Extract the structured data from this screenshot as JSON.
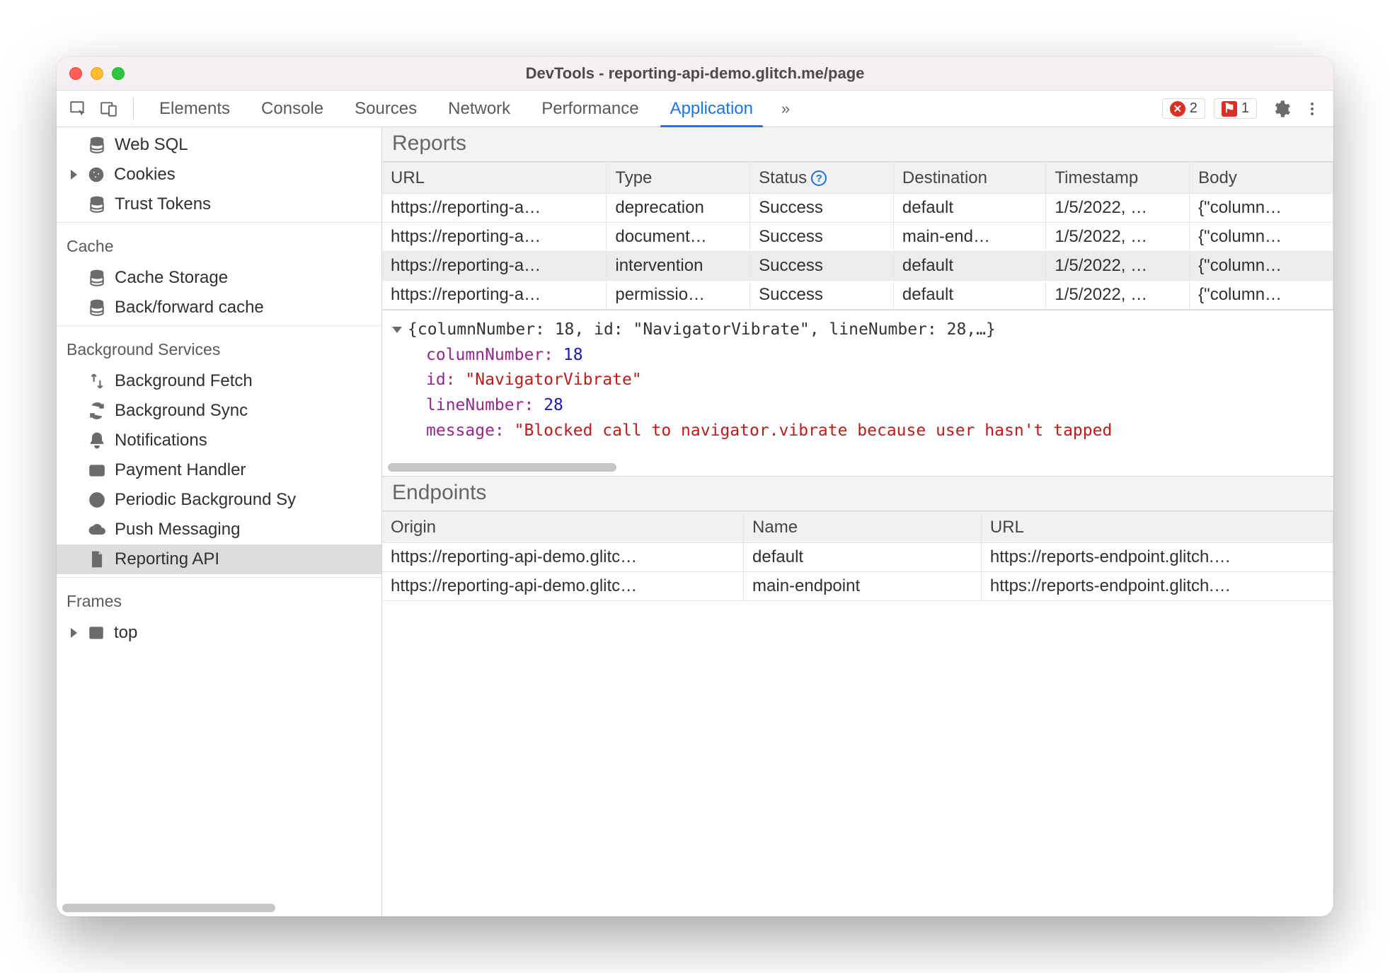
{
  "title": "DevTools - reporting-api-demo.glitch.me/page",
  "tabs": [
    "Elements",
    "Console",
    "Sources",
    "Network",
    "Performance",
    "Application"
  ],
  "active_tab": "Application",
  "overflow_indicator": "»",
  "error_count": "2",
  "issue_count": "1",
  "sidebar": {
    "top_items": [
      {
        "icon": "db",
        "label": "Web SQL"
      },
      {
        "icon": "cookie",
        "label": "Cookies",
        "arrow": true
      },
      {
        "icon": "db",
        "label": "Trust Tokens"
      }
    ],
    "groups": [
      {
        "title": "Cache",
        "items": [
          {
            "icon": "db",
            "label": "Cache Storage"
          },
          {
            "icon": "db",
            "label": "Back/forward cache"
          }
        ]
      },
      {
        "title": "Background Services",
        "items": [
          {
            "icon": "fetch",
            "label": "Background Fetch"
          },
          {
            "icon": "sync",
            "label": "Background Sync"
          },
          {
            "icon": "bell",
            "label": "Notifications"
          },
          {
            "icon": "card",
            "label": "Payment Handler"
          },
          {
            "icon": "clock",
            "label": "Periodic Background Sy"
          },
          {
            "icon": "cloud",
            "label": "Push Messaging"
          },
          {
            "icon": "file",
            "label": "Reporting API",
            "selected": true
          }
        ]
      },
      {
        "title": "Frames",
        "items": [
          {
            "icon": "frame",
            "label": "top",
            "arrow": true
          }
        ]
      }
    ]
  },
  "reports": {
    "heading": "Reports",
    "columns": [
      "URL",
      "Type",
      "Status",
      "Destination",
      "Timestamp",
      "Body"
    ],
    "rows": [
      {
        "url": "https://reporting-a…",
        "type": "deprecation",
        "status": "Success",
        "dest": "default",
        "ts": "1/5/2022, …",
        "body": "{\"column…"
      },
      {
        "url": "https://reporting-a…",
        "type": "document…",
        "status": "Success",
        "dest": "main-end…",
        "ts": "1/5/2022, …",
        "body": "{\"column…"
      },
      {
        "url": "https://reporting-a…",
        "type": "intervention",
        "status": "Success",
        "dest": "default",
        "ts": "1/5/2022, …",
        "body": "{\"column…",
        "selected": true
      },
      {
        "url": "https://reporting-a…",
        "type": "permissio…",
        "status": "Success",
        "dest": "default",
        "ts": "1/5/2022, …",
        "body": "{\"column…"
      }
    ]
  },
  "viewer": {
    "summary": "{columnNumber: 18, id: \"NavigatorVibrate\", lineNumber: 28,…}",
    "columnNumber_key": "columnNumber:",
    "columnNumber_val": "18",
    "id_key": "id:",
    "id_val": "\"NavigatorVibrate\"",
    "lineNumber_key": "lineNumber:",
    "lineNumber_val": "28",
    "message_key": "message:",
    "message_val": "\"Blocked call to navigator.vibrate because user hasn't tapped"
  },
  "endpoints": {
    "heading": "Endpoints",
    "columns": [
      "Origin",
      "Name",
      "URL"
    ],
    "rows": [
      {
        "origin": "https://reporting-api-demo.glitc…",
        "name": "default",
        "url": "https://reports-endpoint.glitch.…"
      },
      {
        "origin": "https://reporting-api-demo.glitc…",
        "name": "main-endpoint",
        "url": "https://reports-endpoint.glitch.…"
      }
    ]
  }
}
